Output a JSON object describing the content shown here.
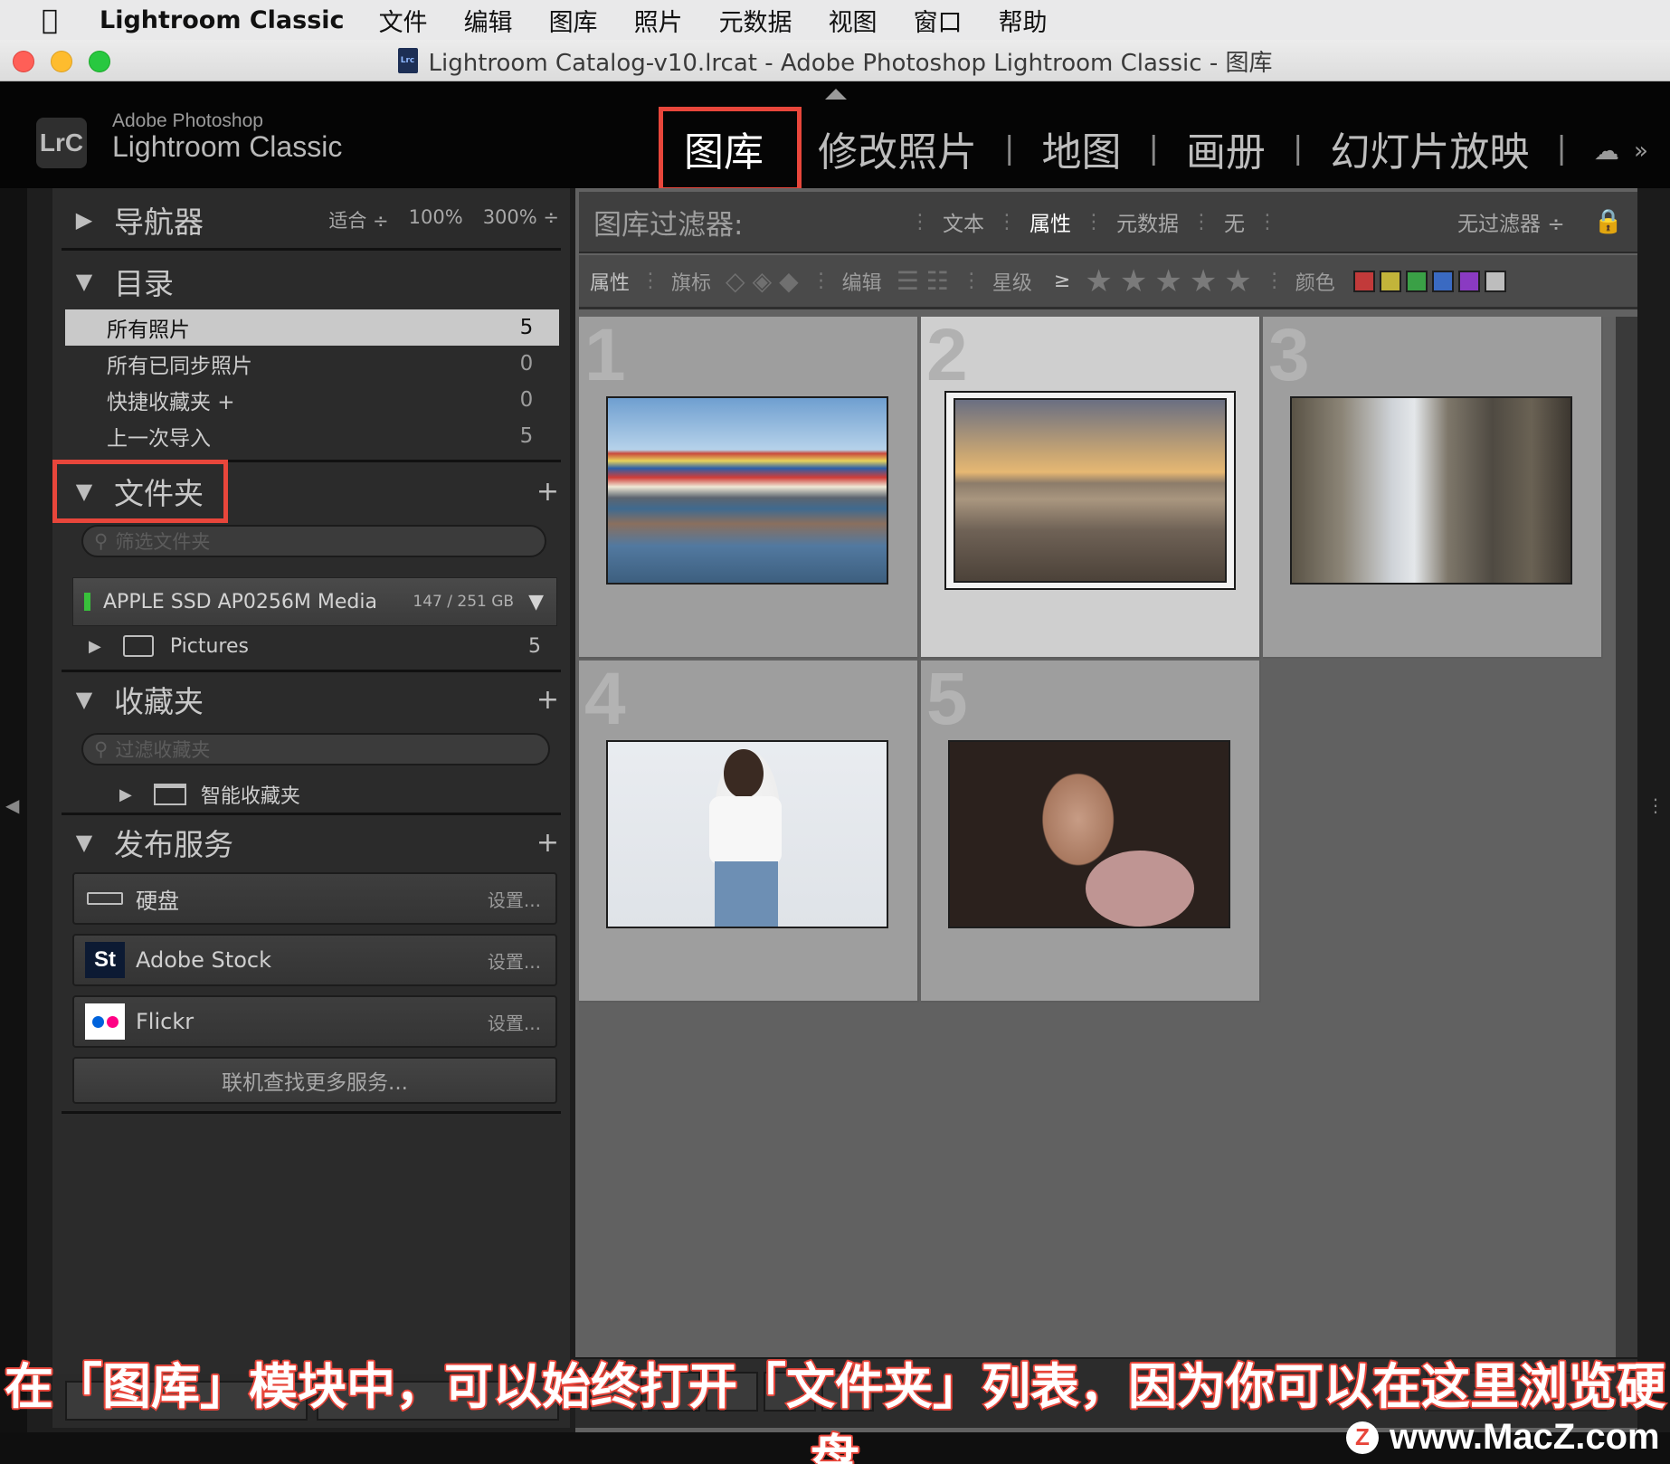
{
  "menubar": {
    "app_name": "Lightroom Classic",
    "items": [
      "文件",
      "编辑",
      "图库",
      "照片",
      "元数据",
      "视图",
      "窗口",
      "帮助"
    ]
  },
  "window": {
    "title": "Lightroom Catalog-v10.lrcat - Adobe Photoshop Lightroom Classic - 图库",
    "doc_icon_label": "Lrc"
  },
  "brand": {
    "logo": "LrC",
    "top": "Adobe Photoshop",
    "main": "Lightroom Classic"
  },
  "modules": {
    "items": [
      "图库",
      "修改照片",
      "地图",
      "画册",
      "幻灯片放映"
    ],
    "separator": "|",
    "active": "图库"
  },
  "navigator": {
    "title": "导航器",
    "zoom": [
      "适合 ÷",
      "100%",
      "300% ÷"
    ]
  },
  "catalog": {
    "title": "目录",
    "items": [
      {
        "label": "所有照片",
        "count": "5"
      },
      {
        "label": "所有已同步照片",
        "count": "0"
      },
      {
        "label": "快捷收藏夹 +",
        "count": "0"
      },
      {
        "label": "上一次导入",
        "count": "5"
      }
    ]
  },
  "folders": {
    "title": "文件夹",
    "search_placeholder": "筛选文件夹",
    "volume": {
      "name": "APPLE SSD AP0256M Media",
      "size": "147 / 251 GB"
    },
    "items": [
      {
        "label": "Pictures",
        "count": "5"
      }
    ]
  },
  "collections": {
    "title": "收藏夹",
    "search_placeholder": "过滤收藏夹",
    "items": [
      {
        "label": "智能收藏夹"
      }
    ]
  },
  "publish": {
    "title": "发布服务",
    "items": [
      {
        "label": "硬盘",
        "action": "设置..."
      },
      {
        "label": "Adobe Stock",
        "action": "设置...",
        "icon_text": "St"
      },
      {
        "label": "Flickr",
        "action": "设置..."
      }
    ],
    "find_more": "联机查找更多服务..."
  },
  "filter_bar": {
    "title": "图库过滤器:",
    "options": [
      "文本",
      "属性",
      "元数据",
      "无"
    ],
    "active": "属性",
    "preset": "无过滤器 ÷"
  },
  "attribute_bar": {
    "label": "属性",
    "flag": "旗标",
    "edit": "编辑",
    "rating": "星级",
    "rating_op": "≥",
    "color": "颜色",
    "swatches": [
      "#c23a3a",
      "#c2b43a",
      "#3aa046",
      "#3a6ac2",
      "#8a3ac2",
      "#bdbdbd"
    ]
  },
  "grid": {
    "cells": [
      {
        "index": "1",
        "selected": false,
        "scene": "harbor"
      },
      {
        "index": "2",
        "selected": true,
        "scene": "beach"
      },
      {
        "index": "3",
        "selected": false,
        "scene": "street"
      },
      {
        "index": "4",
        "selected": false,
        "scene": "woman-white"
      },
      {
        "index": "5",
        "selected": false,
        "scene": "portrait"
      }
    ]
  },
  "overlay": {
    "caption": "在「图库」模块中，可以始终打开「文件夹」列表，因为你可以在这里浏览硬盘",
    "watermark": "www.MacZ.com",
    "watermark_badge": "Z"
  },
  "colors": {
    "highlight": "#e8463b",
    "panel": "#2b2b2b",
    "grid_bg": "#616161"
  }
}
